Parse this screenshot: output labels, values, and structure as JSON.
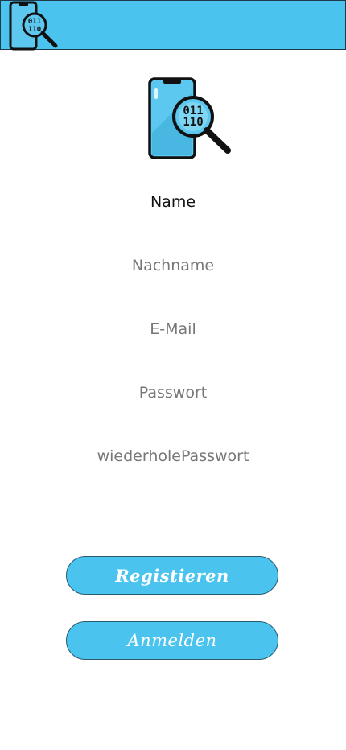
{
  "app": {
    "brand_color": "#4ac4ee",
    "logo_icon": "phone-magnifier-binary-icon"
  },
  "form": {
    "name_value": "Name",
    "lastname_placeholder": "Nachname",
    "email_placeholder": "E-Mail",
    "password_placeholder": "Passwort",
    "repeat_password_placeholder": "wiederholePasswort"
  },
  "actions": {
    "register_label": "Registieren",
    "login_label": "Anmelden"
  }
}
